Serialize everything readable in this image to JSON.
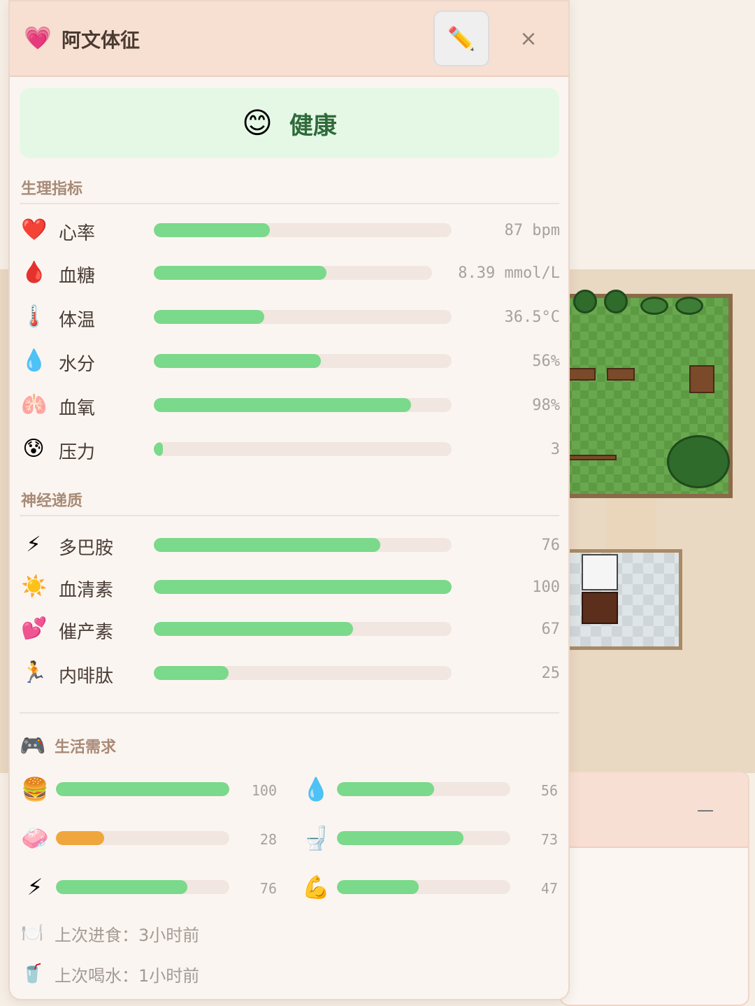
{
  "header": {
    "icon": "💗",
    "title": "阿文体征",
    "edit_icon": "✏️",
    "close_icon": "×"
  },
  "status": {
    "emoji": "😊",
    "label": "健康",
    "color": "#2f6a3a"
  },
  "physiology": {
    "title": "生理指标",
    "items": [
      {
        "icon": "❤️",
        "label": "心率",
        "value": "87 bpm",
        "fill": 0.39
      },
      {
        "icon": "🩸",
        "label": "血糖",
        "value": "8.39 mmol/L",
        "fill": 0.62
      },
      {
        "icon": "🌡️",
        "label": "体温",
        "value": "36.5°C",
        "fill": 0.37
      },
      {
        "icon": "💧",
        "label": "水分",
        "value": "56%",
        "fill": 0.56
      },
      {
        "icon": "🫁",
        "label": "血氧",
        "value": "98%",
        "fill": 0.865
      },
      {
        "icon": "😰",
        "label": "压力",
        "value": "3",
        "fill": 0.03
      }
    ]
  },
  "neuro": {
    "title": "神经递质",
    "items": [
      {
        "icon": "⚡",
        "label": "多巴胺",
        "value": "76",
        "fill": 0.76
      },
      {
        "icon": "☀️",
        "label": "血清素",
        "value": "100",
        "fill": 1.0
      },
      {
        "icon": "💕",
        "label": "催产素",
        "value": "67",
        "fill": 0.67
      },
      {
        "icon": "🏃",
        "label": "内啡肽",
        "value": "25",
        "fill": 0.25
      }
    ]
  },
  "needs": {
    "icon": "🎮",
    "title": "生活需求",
    "items": [
      {
        "icon": "🍔",
        "name": "hunger",
        "value": "100",
        "fill": 1.0,
        "color": "#7ad98a"
      },
      {
        "icon": "💧",
        "name": "thirst",
        "value": "56",
        "fill": 0.56,
        "color": "#7ad98a"
      },
      {
        "icon": "🧼",
        "name": "hygiene",
        "value": "28",
        "fill": 0.28,
        "color": "#efa63c"
      },
      {
        "icon": "🚽",
        "name": "bladder",
        "value": "73",
        "fill": 0.73,
        "color": "#7ad98a"
      },
      {
        "icon": "⚡",
        "name": "energy",
        "value": "76",
        "fill": 0.76,
        "color": "#7ad98a"
      },
      {
        "icon": "💪",
        "name": "fitness",
        "value": "47",
        "fill": 0.47,
        "color": "#7ad98a"
      }
    ]
  },
  "footer": {
    "last_meal_icon": "🍽️",
    "last_meal_label": "上次进食：",
    "last_meal_value": "3小时前",
    "last_drink_icon": "🥤",
    "last_drink_label": "上次喝水：",
    "last_drink_value": "1小时前"
  },
  "background_panel": {
    "minimize_icon": "—"
  }
}
